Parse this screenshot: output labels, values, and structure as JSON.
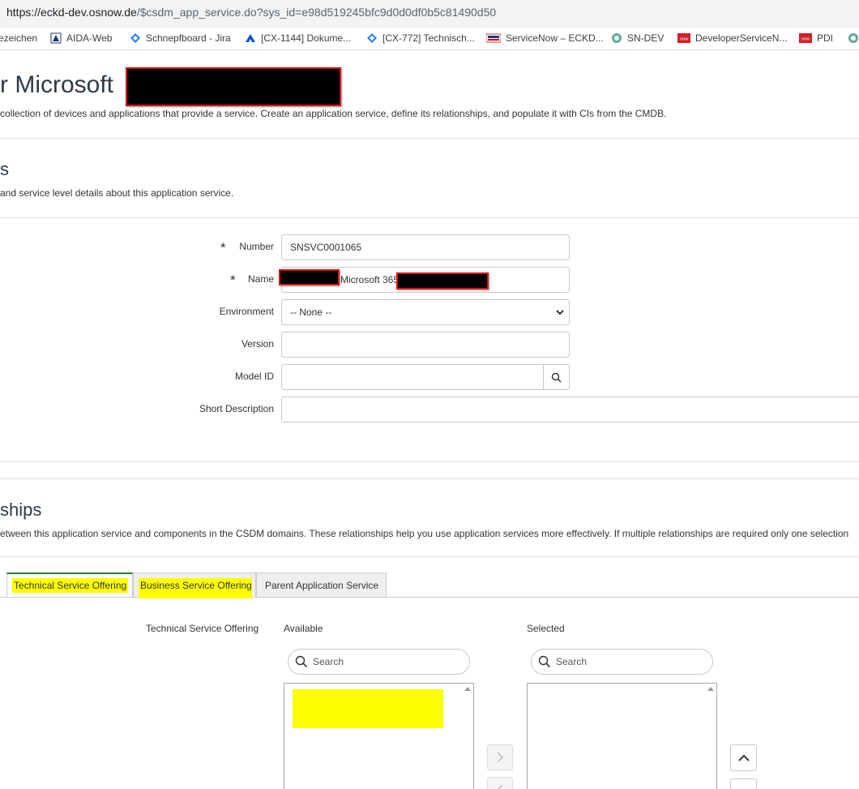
{
  "browser": {
    "url_host": "https://eckd-dev.osnow.de",
    "url_path": "/$csdm_app_service.do?sys_id=e98d519245bfc9d0d0df0b5c81490d50",
    "bookmarks": [
      {
        "label": "ezeichen",
        "icon": "star-icon"
      },
      {
        "label": "AIDA-Web",
        "icon": "aida-icon"
      },
      {
        "label": "Schnepfboard - Jira",
        "icon": "jira-icon"
      },
      {
        "label": "[CX-1144] Dokume...",
        "icon": "confluence-icon"
      },
      {
        "label": "[CX-772] Technisch...",
        "icon": "jira-icon"
      },
      {
        "label": "ServiceNow – ECKD...",
        "icon": "eckd-icon"
      },
      {
        "label": "SN-DEV",
        "icon": "servicenow-icon"
      },
      {
        "label": "DeveloperServiceN...",
        "icon": "now-icon"
      },
      {
        "label": "PDI",
        "icon": "now-icon"
      }
    ]
  },
  "header": {
    "title": "r Microsoft",
    "description": "collection of devices and applications that provide a service. Create an application service, define its relationships, and populate it with CIs from the CMDB."
  },
  "details": {
    "title": "s",
    "description": "and service level details about this application service."
  },
  "form": {
    "number": {
      "label": "Number",
      "value": "SNSVC0001065",
      "required": "*"
    },
    "name": {
      "label": "Name",
      "value": "Microsoft 365",
      "required": "*"
    },
    "environment": {
      "label": "Environment",
      "value": "-- None --"
    },
    "version": {
      "label": "Version",
      "value": ""
    },
    "model_id": {
      "label": "Model ID",
      "value": ""
    },
    "short_description": {
      "label": "Short Description",
      "value": ""
    }
  },
  "relationships": {
    "title": "ships",
    "description": "etween this application service and components in the CSDM domains. These relationships help you use application services more effectively. If multiple relationships are required only one selection"
  },
  "tabs": [
    {
      "label": "Technical Service Offering"
    },
    {
      "label": "Business Service Offering"
    },
    {
      "label": "Parent Application Service"
    }
  ],
  "slushbucket": {
    "field_label": "Technical Service Offering",
    "available_label": "Available",
    "selected_label": "Selected",
    "search_placeholder": "Search"
  },
  "colors": {
    "highlight": "#ffff00",
    "active_tab_border": "#2e7d32",
    "redaction": "#000000"
  }
}
